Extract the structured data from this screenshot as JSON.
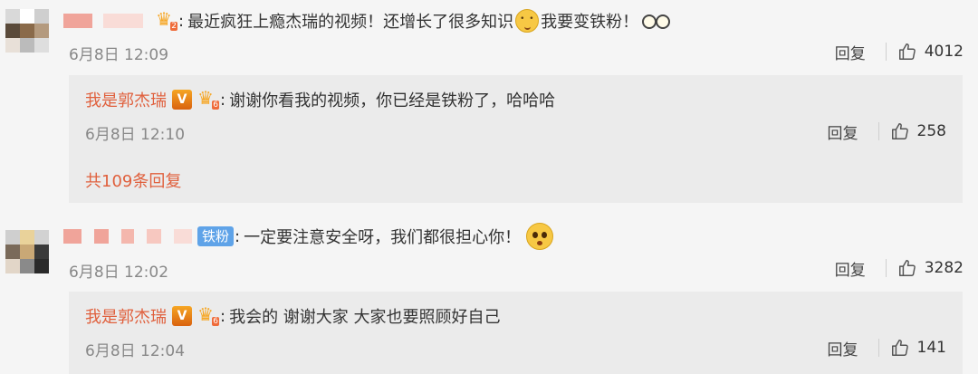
{
  "colors": {
    "background": "#f5f5f5",
    "reply_box": "#ebebeb",
    "accent": "#e0603d",
    "muted_text": "#888888",
    "fan_badge": "#5fa3e8",
    "v_badge": "#f39c12"
  },
  "comments": [
    {
      "text_part1": "最近疯狂上瘾杰瑞的视频！还增长了很多知识",
      "text_part2": "我要变铁粉！",
      "date": "6月8日 12:09",
      "reply_label": "回复",
      "likes": "4012",
      "reply": {
        "author": "我是郭杰瑞",
        "text": "谢谢你看我的视频，你已经是铁粉了，哈哈哈",
        "date": "6月8日 12:10",
        "reply_label": "回复",
        "likes": "258",
        "total_replies": "共109条回复"
      }
    },
    {
      "badge": "铁粉",
      "text": "一定要注意安全呀，我们都很担心你！",
      "date": "6月8日 12:02",
      "reply_label": "回复",
      "likes": "3282",
      "reply": {
        "author": "我是郭杰瑞",
        "text": "我会的 谢谢大家 大家也要照顾好自己",
        "date": "6月8日 12:04",
        "reply_label": "回复",
        "likes": "141"
      }
    }
  ],
  "badges": {
    "v_label": "V",
    "level_label": "6"
  },
  "icons": {
    "like": "thumbs-up-icon",
    "crown": "crown-icon",
    "emoji_smile": "smile-emoji-icon",
    "emoji_glasses": "glasses-emoji-icon",
    "emoji_worried": "worried-emoji-icon"
  }
}
